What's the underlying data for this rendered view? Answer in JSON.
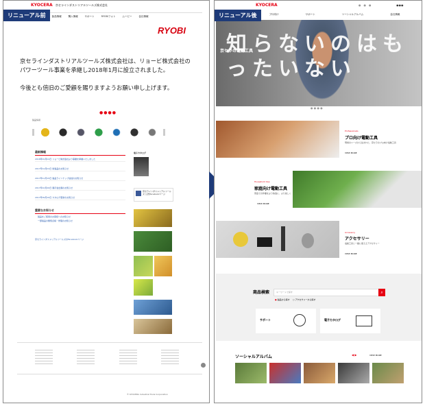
{
  "before": {
    "tag": "リニューアル前",
    "header_logo": "KYOCERA",
    "header_company": "京セラインダストリアルツールズ株式会社",
    "header_links": [
      "HOME",
      "製品情報",
      "購入情報",
      "サポート",
      "RYOBIフォト",
      "ムービー",
      "会社情報"
    ],
    "ryobi_logo": "RYOBI",
    "main_text": "京セラインダストリアルツールズ株式会社は、リョービ株式会社のパワーツール事業を承継し2018年1月に設立されました。",
    "main_text2": "今後とも倍旧のご愛顧を賜りますようお願い申し上げます。",
    "section_label": "製品情報",
    "news_title": "最新情報",
    "news_items": [
      "2018年01月01日 リョービ株式会社より事業を承継いたしました",
      "2017年12月01日 新製品のお知らせ",
      "2017年11月15日 製品ラインナップ追加のお知らせ",
      "2017年10月20日 展示会出展のお知らせ",
      "2017年09月10日 カタログ更新のお知らせ"
    ],
    "important_title": "重要なお知らせ",
    "important_items": [
      "製品をご使用のお客様へのお知らせ",
      "一部製品の無償点検・修理のお知らせ"
    ],
    "facebook_link": "京セラインダストリアルツールズのFacebookページ",
    "catalog_label": "電子カタログ",
    "fb_banner": "京セラインダストリアルツールズ 公式Facebookページ",
    "footer_label": "© KYOCERA Industrial Tools Corporation"
  },
  "after": {
    "tag": "リニューアル後",
    "header_logo": "KYOCERA",
    "header_links": [
      "プロ向け",
      "サポート",
      "ソーシャルアルバム",
      "会社情報"
    ],
    "hero_big": "知らないのはもったいない",
    "hero_title": "京セラの電動工具",
    "pro_label": "Professionals",
    "pro_title": "プロ向け電動工具",
    "pro_desc": "現場のニーズから生まれた、京セラのプロ向け電動工具",
    "home_label": "Household Use",
    "home_title": "家庭向け電動工具",
    "home_desc": "家庭での作業をより快適に、より楽しく",
    "acc_label": "Accessory",
    "acc_title": "アクセサリー",
    "acc_desc": "電動工具と一緒に使えるアクセサリー",
    "view_more": "VIEW MORE",
    "search_title": "商品検索",
    "search_placeholder": "キーワードで探す",
    "radio1": "製品から探す",
    "radio2": "アクセサリーから探す",
    "support_title": "サポート",
    "catalog_title": "電子カタログ",
    "social_title": "ソーシャルアルバム"
  },
  "colors": {
    "navy": "#1e3b79",
    "kyocera_red": "#e60012",
    "ryobi_red": "#d7000f"
  }
}
